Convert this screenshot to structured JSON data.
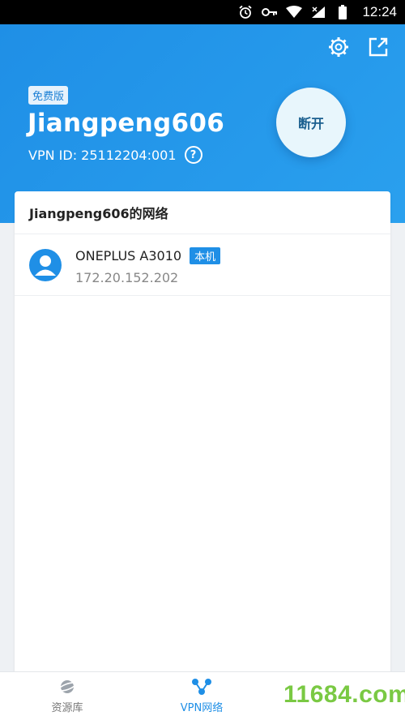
{
  "status_bar": {
    "time": "12:24"
  },
  "header": {
    "badge": "免费版",
    "account_name": "Jiangpeng606",
    "vpn_id": "VPN ID: 25112204:001",
    "help_glyph": "?",
    "disconnect_label": "断开"
  },
  "network": {
    "title": "Jiangpeng606的网络",
    "devices": [
      {
        "name": "ONEPLUS A3010",
        "tag": "本机",
        "ip": "172.20.152.202"
      }
    ]
  },
  "bottom_nav": {
    "items": [
      {
        "label": "资源库",
        "icon": "planet-icon"
      },
      {
        "label": "VPN网络",
        "icon": "network-nodes-icon",
        "active": true
      }
    ]
  },
  "watermark": "11684.com",
  "colors": {
    "primary": "#1f8fe6",
    "watermark": "#7ac943"
  }
}
